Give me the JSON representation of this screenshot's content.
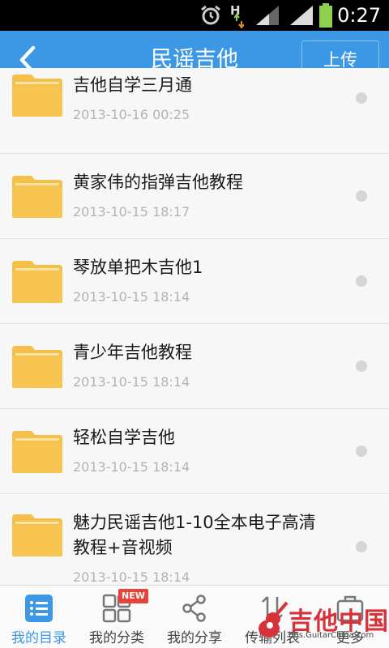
{
  "status_bar": {
    "time": "0:27",
    "network_label": "H"
  },
  "header": {
    "title": "民谣吉他",
    "upload_label": "上传"
  },
  "items": [
    {
      "name": "吉他自学三月通",
      "date": "2013-10-16  00:25"
    },
    {
      "name": "黄家伟的指弹吉他教程",
      "date": "2013-10-15  18:17"
    },
    {
      "name": "琴放单把木吉他1",
      "date": "2013-10-15  18:14"
    },
    {
      "name": "青少年吉他教程",
      "date": "2013-10-15  18:14"
    },
    {
      "name": "轻松自学吉他",
      "date": "2013-10-15  18:14"
    },
    {
      "name": "魅力民谣吉他1-10全本电子高清教程+音视频",
      "date": "2013-10-15  18:14"
    }
  ],
  "tabs": [
    {
      "label": "我的目录",
      "icon": "list-icon",
      "active": true
    },
    {
      "label": "我的分类",
      "icon": "grid-icon",
      "badge": "NEW"
    },
    {
      "label": "我的分享",
      "icon": "share-icon"
    },
    {
      "label": "传输列表",
      "icon": "transfer-icon"
    },
    {
      "label": "更多",
      "icon": "more-icon"
    }
  ],
  "watermark": {
    "text": "吉他中国",
    "url": "bbs.GuitarChina.com"
  },
  "colors": {
    "primary": "#3c98e5",
    "folder": "#f5c04a",
    "badge": "#e8433a",
    "watermark": "#d7323a"
  }
}
